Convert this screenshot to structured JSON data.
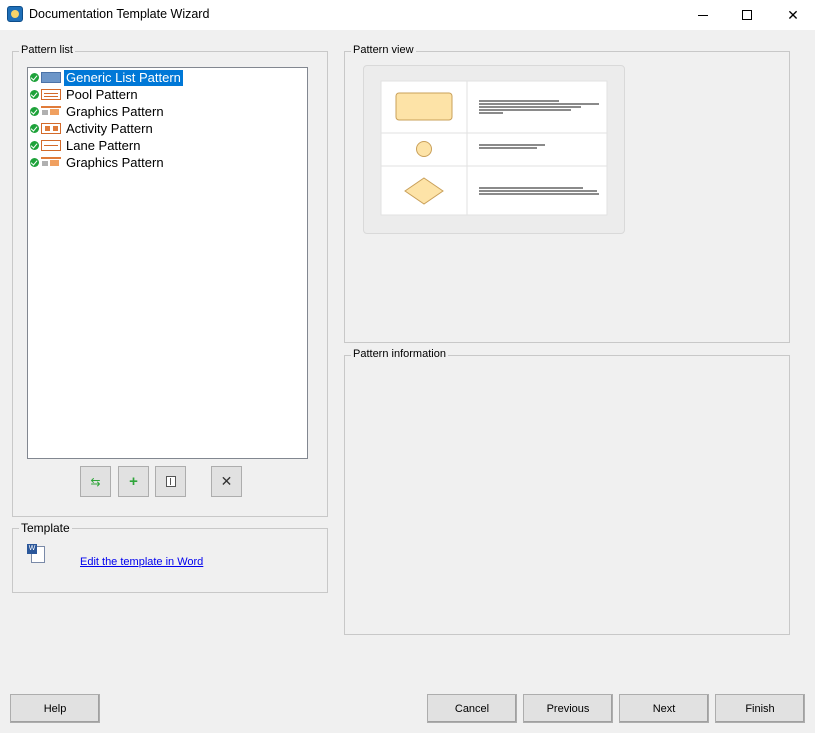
{
  "window": {
    "title": "Documentation Template Wizard"
  },
  "pattern_list": {
    "label": "Pattern list",
    "items": [
      {
        "label": "Generic List Pattern",
        "icon": "list-pattern-icon",
        "selected": true
      },
      {
        "label": "Pool Pattern",
        "icon": "pool-pattern-icon",
        "selected": false
      },
      {
        "label": "Graphics Pattern",
        "icon": "graphics-pattern-icon",
        "selected": false
      },
      {
        "label": "Activity Pattern",
        "icon": "activity-pattern-icon",
        "selected": false
      },
      {
        "label": "Lane Pattern",
        "icon": "lane-pattern-icon",
        "selected": false
      },
      {
        "label": "Graphics Pattern",
        "icon": "graphics-pattern-icon",
        "selected": false
      }
    ]
  },
  "template": {
    "label": "Template",
    "edit_link": "Edit the template in Word"
  },
  "pattern_view": {
    "label": "Pattern view"
  },
  "pattern_information": {
    "label": "Pattern information"
  },
  "buttons": {
    "help": "Help",
    "cancel": "Cancel",
    "previous": "Previous",
    "next": "Next",
    "finish": "Finish"
  },
  "colors": {
    "selection": "#0078d7",
    "shape_fill": "#fde3a7",
    "shape_stroke": "#c9a05a",
    "check": "#1ea23a"
  }
}
